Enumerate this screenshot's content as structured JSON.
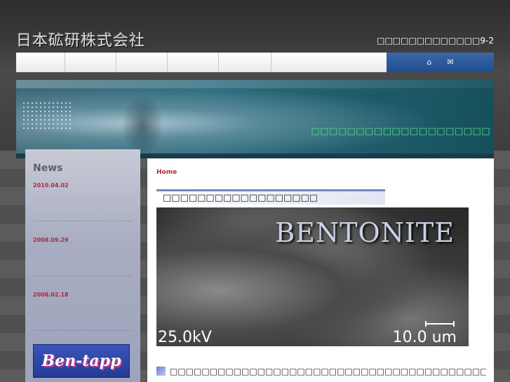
{
  "header": {
    "logo_text": "日本砿研株式会社",
    "address": "□□□□□□□□□□□□□9-2"
  },
  "nav": {
    "item_count": 5,
    "home_icon": "home-icon",
    "mail_icon": "mail-icon"
  },
  "hero": {
    "tagline": "□□□□□□□□□□□□□□□□□□□□"
  },
  "sidebar": {
    "title": "News",
    "items": [
      {
        "date": "2010.04.02"
      },
      {
        "date": "2008.09.29"
      },
      {
        "date": "2008.02.18"
      }
    ],
    "banner_text": "Ben-tapp"
  },
  "main": {
    "breadcrumb": "Home",
    "section_title": "□□□□□□□□□□□□□□□□□□",
    "photo": {
      "title": "BENTONITE",
      "voltage": "25.0kV",
      "scale": "10.0 um"
    },
    "intro_text": "□□□□□□□□□□□□□□□□□□□□□□□□□□□□□□□□□□□□□□□□□□□□□□□□□□□□□□□□□□□□□□"
  },
  "colors": {
    "accent_red": "#b5273a",
    "hero_text_green": "#55e08a",
    "nav_blue": "#2a5799"
  }
}
